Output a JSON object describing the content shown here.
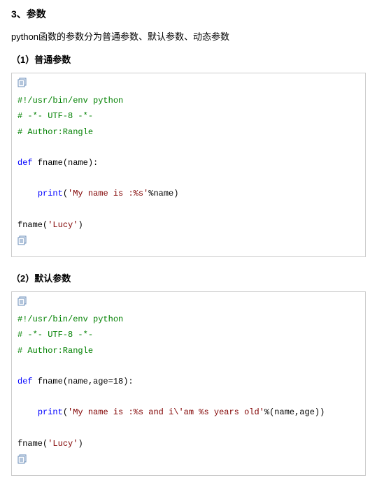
{
  "heading": "3、参数",
  "intro": "python函数的参数分为普通参数、默认参数、动态参数",
  "section1": {
    "title": "（1）普通参数",
    "code": {
      "l1": "#!/usr/bin/env python",
      "l2": "# -*- UTF-8 -*-",
      "l3": "# Author:Rangle",
      "l4_kw": "def",
      "l4_rest": " fname(name):",
      "l5_kw": "print",
      "l5_paren_open": "(",
      "l5_str": "'My name is :%s'",
      "l5_rest": "%name)",
      "l6_call": "fname(",
      "l6_str": "'Lucy'",
      "l6_close": ")"
    }
  },
  "section2": {
    "title": "（2）默认参数",
    "code": {
      "l1": "#!/usr/bin/env python",
      "l2": "# -*- UTF-8 -*-",
      "l3": "# Author:Rangle",
      "l4_kw": "def",
      "l4_rest": " fname(name,age=18):",
      "l5_kw": "print",
      "l5_paren_open": "(",
      "l5_str": "'My name is :%s and i\\'am %s years old'",
      "l5_rest": "%(name,age))",
      "l6_call": "fname(",
      "l6_str": "'Lucy'",
      "l6_close": ")"
    }
  }
}
